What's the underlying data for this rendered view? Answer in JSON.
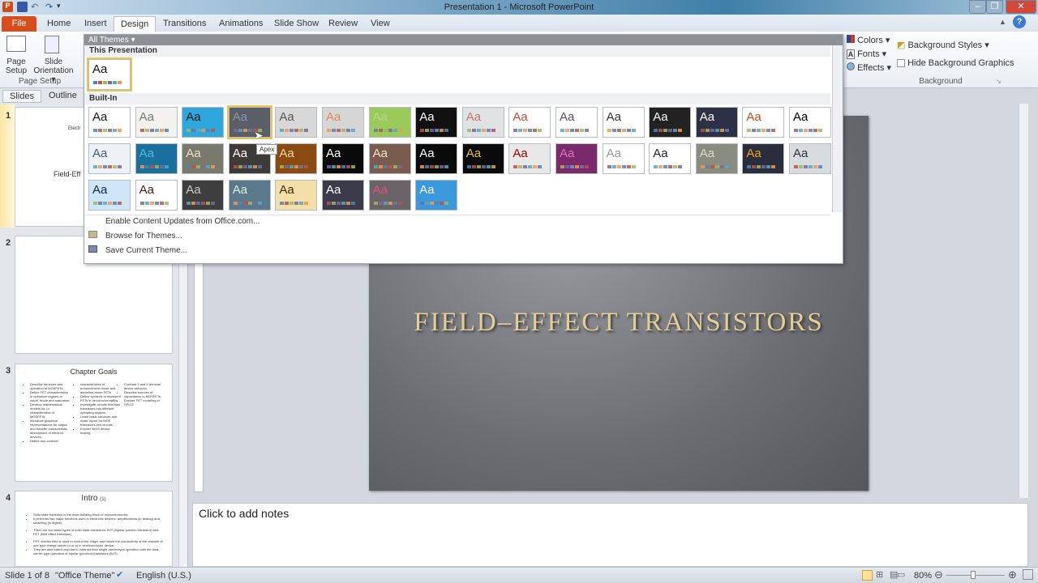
{
  "window": {
    "title": "Presentation 1  -  Microsoft PowerPoint",
    "minimize": "–",
    "restore": "❐",
    "close": "✕"
  },
  "tabs": [
    "File",
    "Home",
    "Insert",
    "Design",
    "Transitions",
    "Animations",
    "Slide Show",
    "Review",
    "View"
  ],
  "active_tab": "Design",
  "ribbon": {
    "page_setup": "Page\nSetup",
    "page_setup_l1": "Page",
    "page_setup_l2": "Setup",
    "slide_orient_l1": "Slide",
    "slide_orient_l2": "Orientation ▾",
    "group_page_setup": "Page Setup",
    "colors": "Colors ▾",
    "fonts": "Fonts ▾",
    "effects": "Effects ▾",
    "bg_styles": "Background Styles ▾",
    "hide_bg": "Hide Background Graphics",
    "group_background": "Background",
    "help": "?"
  },
  "gallery": {
    "header": "All Themes ▾",
    "this_presentation": "This Presentation",
    "built_in": "Built-In",
    "tooltip": "Apex",
    "current_theme_aa": "Aa",
    "menu": [
      "Enable Content Updates from Office.com...",
      "Browse for Themes...",
      "Save Current Theme..."
    ],
    "themes": [
      {
        "bg": "#ffffff",
        "fg": "#111111"
      },
      {
        "bg": "#f4f2ee",
        "fg": "#777777"
      },
      {
        "bg": "#2ea8dc",
        "fg": "#111111"
      },
      {
        "bg": "#5a5e66",
        "fg": "#8c93b0"
      },
      {
        "bg": "#d8d8d8",
        "fg": "#555555"
      },
      {
        "bg": "#d6d6d6",
        "fg": "#e4875a"
      },
      {
        "bg": "#9acb5a",
        "fg": "#b4d88a"
      },
      {
        "bg": "#111111",
        "fg": "#ffffff"
      },
      {
        "bg": "#dfe3e6",
        "fg": "#d07060"
      },
      {
        "bg": "#ffffff",
        "fg": "#c84b3a"
      },
      {
        "bg": "#ffffff",
        "fg": "#555555"
      },
      {
        "bg": "#ffffff",
        "fg": "#333333"
      },
      {
        "bg": "#222222",
        "fg": "#ffffff"
      },
      {
        "bg": "#2e3046",
        "fg": "#ffffff"
      },
      {
        "bg": "#ffffff",
        "fg": "#c84b1c"
      },
      {
        "bg": "#ffffff",
        "fg": "#000000"
      },
      {
        "bg": "#eef2f6",
        "fg": "#3c5a86"
      },
      {
        "bg": "#1b6f9c",
        "fg": "#4fb8e8"
      },
      {
        "bg": "#7a7a6c",
        "fg": "#e6e0c8"
      },
      {
        "bg": "#3d3a38",
        "fg": "#ffffff"
      },
      {
        "bg": "#8a4b12",
        "fg": "#f0d8a0"
      },
      {
        "bg": "#0a0a0a",
        "fg": "#ffffff"
      },
      {
        "bg": "#7a5c4e",
        "fg": "#f0e0d0"
      },
      {
        "bg": "#0a0a0a",
        "fg": "#ffffff"
      },
      {
        "bg": "#0a0a0a",
        "fg": "#f0c020"
      },
      {
        "bg": "#e8e8e8",
        "fg": "#b00000"
      },
      {
        "bg": "#7a2a6a",
        "fg": "#e070c0"
      },
      {
        "bg": "#ffffff",
        "fg": "#999999"
      },
      {
        "bg": "#ffffff",
        "fg": "#222222"
      },
      {
        "bg": "#8a8c80",
        "fg": "#dcdccc"
      },
      {
        "bg": "#2a2e3c",
        "fg": "#f0a020"
      },
      {
        "bg": "#d8dce0",
        "fg": "#333333"
      },
      {
        "bg": "#cfe6f8",
        "fg": "#0a2a50"
      },
      {
        "bg": "#ffffff",
        "fg": "#4a1a1a"
      },
      {
        "bg": "#3e3e3e",
        "fg": "#cccccc"
      },
      {
        "bg": "#5a7a8c",
        "fg": "#e0f0e0"
      },
      {
        "bg": "#f3dfa8",
        "fg": "#3a2a10"
      },
      {
        "bg": "#3a3a4a",
        "fg": "#ffffff"
      },
      {
        "bg": "#6a6468",
        "fg": "#e05070"
      },
      {
        "bg": "#3a98dc",
        "fg": "#ffffff"
      }
    ],
    "swatch_colors": [
      "#4f81bd",
      "#c0504d",
      "#9bbb59",
      "#8064a2",
      "#4bacc6",
      "#f79646"
    ]
  },
  "left_pane": {
    "tabs": [
      "Slides",
      "Outline"
    ],
    "slides": [
      {
        "num": "1",
        "line1": "Electr",
        "line2": "Field-Eff"
      },
      {
        "num": "2"
      },
      {
        "num": "3",
        "title": "Chapter Goals",
        "col1": [
          "Describe structure and operation of MOSFETs.",
          "Define FET characteristics in operation regions of cutoff, triode and saturation.",
          "Develop mathematical models for i-v characteristics of MOSFETs.",
          "Introduce graphical representations for output and transfer characteristic descriptions of electron devices.",
          "Define and contrast"
        ],
        "col2": [
          "characteristics of enhancement-mode and depletion-mode FETs.",
          "Define symbols to represent FETs in circuit schematics.",
          "Investigate circuits that bias transistors into different operating regions.",
          "Learn basic structure and mask layout for MOS transistors and circuits.",
          "Explore MOS device scaling"
        ],
        "col3": [
          "Contrast 3 and 4 terminal device behavior.",
          "Describe sources of capacitance in MOSFETs.",
          "Explore FET modeling in SPICE."
        ]
      },
      {
        "num": "4",
        "title": "Intro",
        "title_sub": "(1)",
        "bullets": [
          "Solid state transistor is the main building block of microelectronics.",
          "It performs two major functions used in electronic devices: amplifications (in analog) and switching (in digital).",
          "There are two basic types of solid state transistors: BJT (bipolar junction transistor) and FET (field effect transistor).",
          "FET: electric field is used to control the shape and hence the conductivity of the channel of one type charge carrier (n or p) in semiconductor device.",
          "They are also called unipolar to contrast their single-carrier-type operation with the dual-carrier-type operation of bipolar (junction) transistors (BJT)."
        ]
      }
    ]
  },
  "slide": {
    "title": "FIELD–EFFECT TRANSISTORS"
  },
  "notes": {
    "placeholder": "Click to add notes"
  },
  "status": {
    "slide": "Slide 1 of 8",
    "theme": "\"Office Theme\"",
    "language": "English (U.S.)",
    "zoom": "80%",
    "zoom_percent": 80
  }
}
